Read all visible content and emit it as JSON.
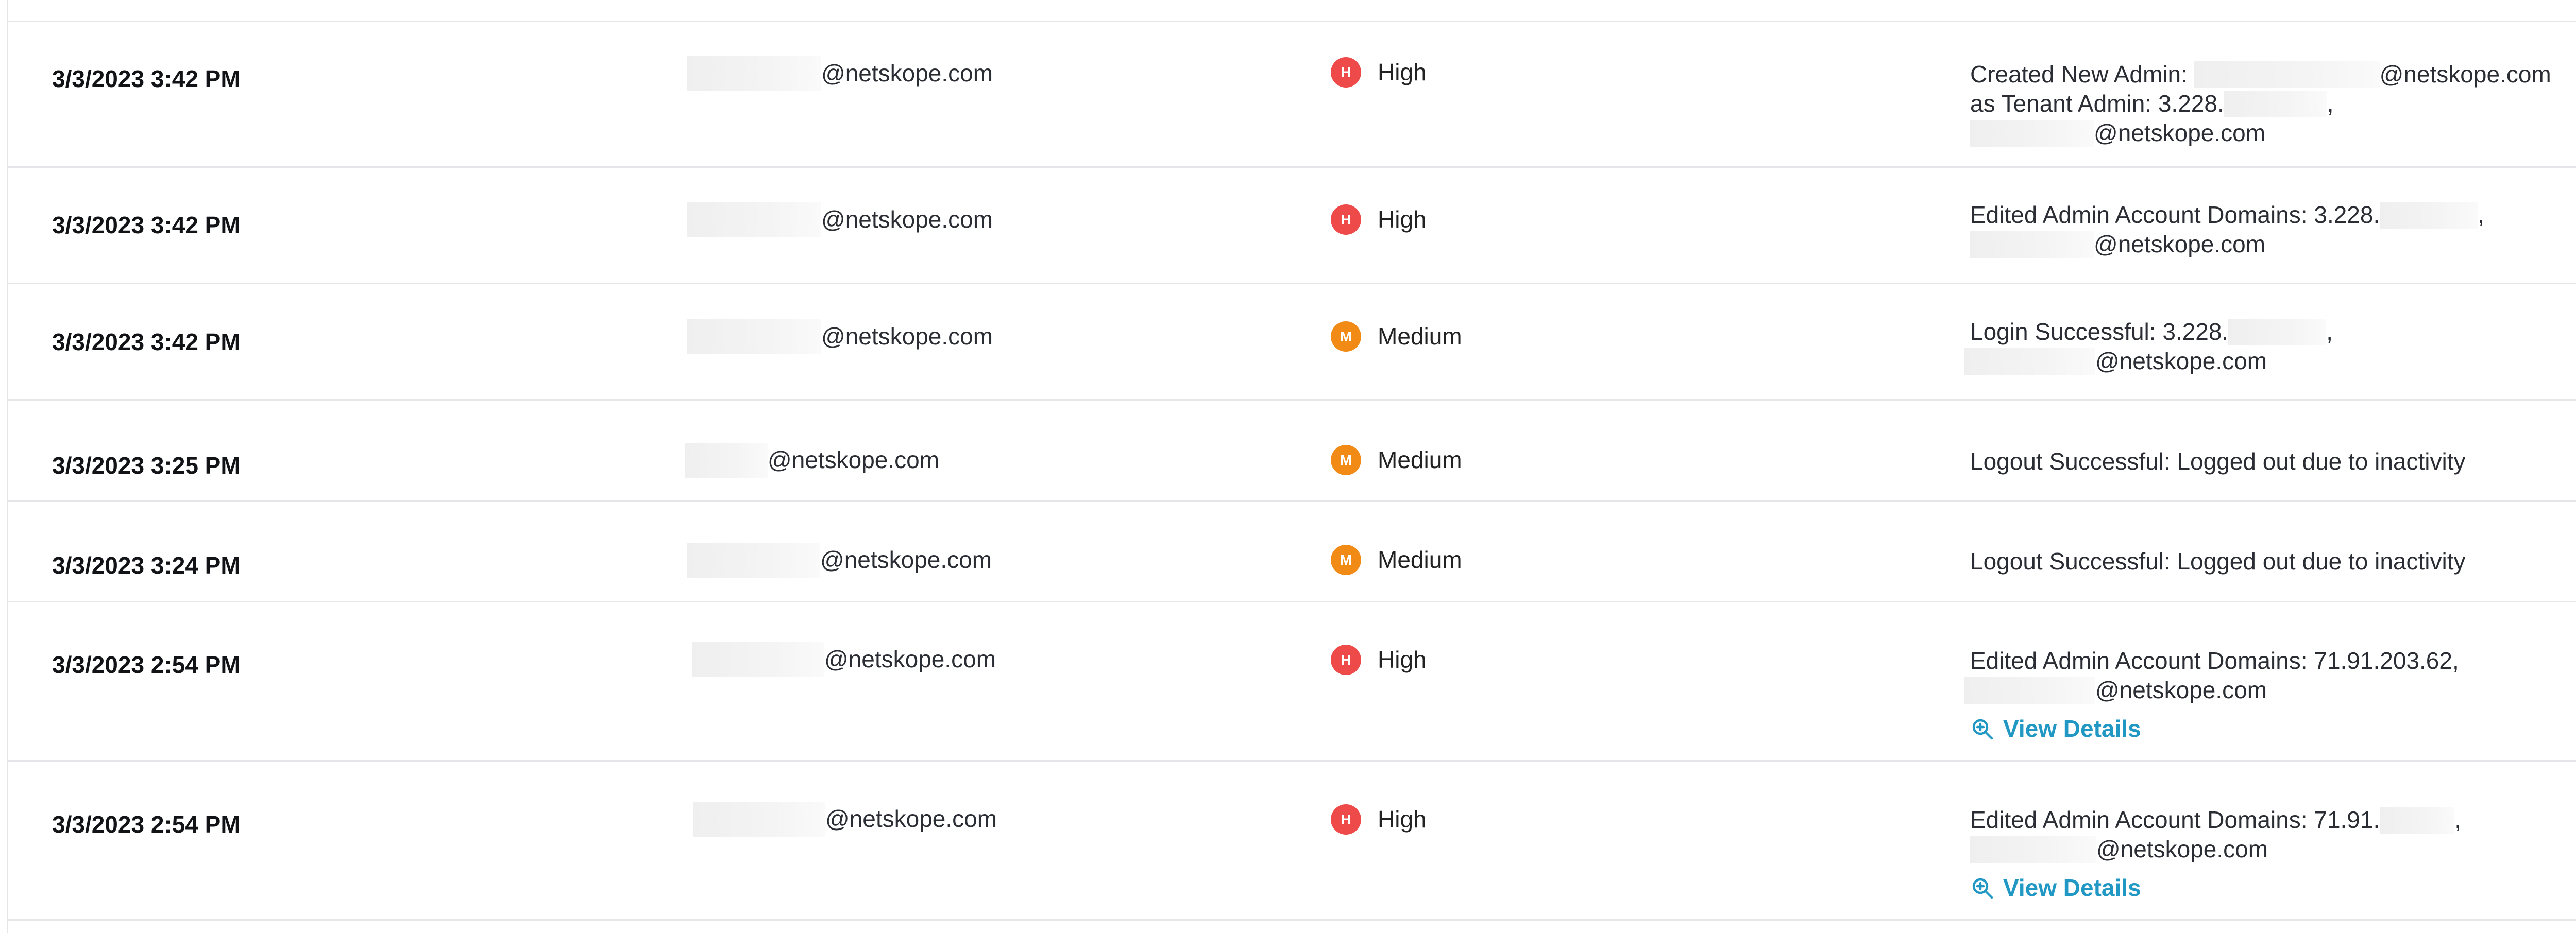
{
  "colors": {
    "high": "#ef4a4a",
    "medium": "#f28a16",
    "link": "#2198c4",
    "border": "#e4e6ea"
  },
  "rows": [
    {
      "time": "3/3/2023 3:42 PM",
      "user": "@netskope.com",
      "severity_badge": "H",
      "severity": "High",
      "details": [
        "Created New Admin: ",
        "as Tenant Admin: 3.228.",
        "@netskope.com"
      ],
      "details_suffix": [
        "@netskope.com",
        ",",
        ""
      ]
    },
    {
      "time": "3/3/2023 3:42 PM",
      "user": "@netskope.com",
      "severity_badge": "H",
      "severity": "High",
      "details": [
        "Edited Admin Account Domains: 3.228.",
        "@netskope.com"
      ],
      "details_suffix": [
        ",",
        ""
      ]
    },
    {
      "time": "3/3/2023 3:42 PM",
      "user": "@netskope.com",
      "severity_badge": "M",
      "severity": "Medium",
      "details": [
        "Login Successful: 3.228.",
        "@netskope.com"
      ],
      "details_suffix": [
        ",",
        ""
      ]
    },
    {
      "time": "3/3/2023 3:25 PM",
      "user": "@netskope.com",
      "severity_badge": "M",
      "severity": "Medium",
      "details": [
        "Logout Successful: Logged out due to inactivity"
      ],
      "details_suffix": [
        ""
      ]
    },
    {
      "time": "3/3/2023 3:24 PM",
      "user": "@netskope.com",
      "severity_badge": "M",
      "severity": "Medium",
      "details": [
        "Logout Successful: Logged out due to inactivity"
      ],
      "details_suffix": [
        ""
      ]
    },
    {
      "time": "3/3/2023 2:54 PM",
      "user": "@netskope.com",
      "severity_badge": "H",
      "severity": "High",
      "details": [
        "Edited Admin Account Domains: 71.91.203.62,",
        "@netskope.com"
      ],
      "details_suffix": [
        "",
        ""
      ],
      "view_details": "View Details"
    },
    {
      "time": "3/3/2023 2:54 PM",
      "user": "@netskope.com",
      "severity_badge": "H",
      "severity": "High",
      "details": [
        "Edited Admin Account Domains: 71.91.",
        "@netskope.com"
      ],
      "details_suffix": [
        ",",
        ""
      ],
      "view_details": "View Details"
    }
  ],
  "icons": {
    "view_details": "zoom-in-icon"
  }
}
